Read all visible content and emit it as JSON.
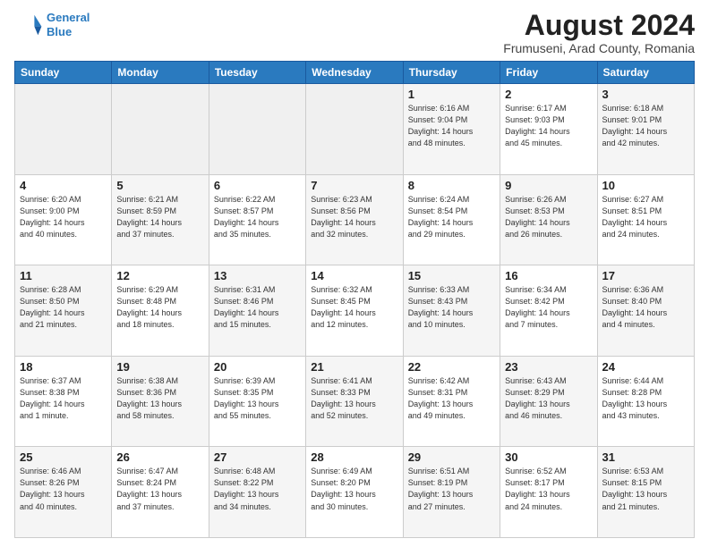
{
  "header": {
    "logo_line1": "General",
    "logo_line2": "Blue",
    "month": "August 2024",
    "location": "Frumuseni, Arad County, Romania"
  },
  "weekdays": [
    "Sunday",
    "Monday",
    "Tuesday",
    "Wednesday",
    "Thursday",
    "Friday",
    "Saturday"
  ],
  "weeks": [
    [
      {
        "day": "",
        "info": "",
        "empty": true
      },
      {
        "day": "",
        "info": "",
        "empty": true
      },
      {
        "day": "",
        "info": "",
        "empty": true
      },
      {
        "day": "",
        "info": "",
        "empty": true
      },
      {
        "day": "1",
        "info": "Sunrise: 6:16 AM\nSunset: 9:04 PM\nDaylight: 14 hours\nand 48 minutes.",
        "empty": false
      },
      {
        "day": "2",
        "info": "Sunrise: 6:17 AM\nSunset: 9:03 PM\nDaylight: 14 hours\nand 45 minutes.",
        "empty": false
      },
      {
        "day": "3",
        "info": "Sunrise: 6:18 AM\nSunset: 9:01 PM\nDaylight: 14 hours\nand 42 minutes.",
        "empty": false
      }
    ],
    [
      {
        "day": "4",
        "info": "Sunrise: 6:20 AM\nSunset: 9:00 PM\nDaylight: 14 hours\nand 40 minutes.",
        "empty": false
      },
      {
        "day": "5",
        "info": "Sunrise: 6:21 AM\nSunset: 8:59 PM\nDaylight: 14 hours\nand 37 minutes.",
        "empty": false
      },
      {
        "day": "6",
        "info": "Sunrise: 6:22 AM\nSunset: 8:57 PM\nDaylight: 14 hours\nand 35 minutes.",
        "empty": false
      },
      {
        "day": "7",
        "info": "Sunrise: 6:23 AM\nSunset: 8:56 PM\nDaylight: 14 hours\nand 32 minutes.",
        "empty": false
      },
      {
        "day": "8",
        "info": "Sunrise: 6:24 AM\nSunset: 8:54 PM\nDaylight: 14 hours\nand 29 minutes.",
        "empty": false
      },
      {
        "day": "9",
        "info": "Sunrise: 6:26 AM\nSunset: 8:53 PM\nDaylight: 14 hours\nand 26 minutes.",
        "empty": false
      },
      {
        "day": "10",
        "info": "Sunrise: 6:27 AM\nSunset: 8:51 PM\nDaylight: 14 hours\nand 24 minutes.",
        "empty": false
      }
    ],
    [
      {
        "day": "11",
        "info": "Sunrise: 6:28 AM\nSunset: 8:50 PM\nDaylight: 14 hours\nand 21 minutes.",
        "empty": false
      },
      {
        "day": "12",
        "info": "Sunrise: 6:29 AM\nSunset: 8:48 PM\nDaylight: 14 hours\nand 18 minutes.",
        "empty": false
      },
      {
        "day": "13",
        "info": "Sunrise: 6:31 AM\nSunset: 8:46 PM\nDaylight: 14 hours\nand 15 minutes.",
        "empty": false
      },
      {
        "day": "14",
        "info": "Sunrise: 6:32 AM\nSunset: 8:45 PM\nDaylight: 14 hours\nand 12 minutes.",
        "empty": false
      },
      {
        "day": "15",
        "info": "Sunrise: 6:33 AM\nSunset: 8:43 PM\nDaylight: 14 hours\nand 10 minutes.",
        "empty": false
      },
      {
        "day": "16",
        "info": "Sunrise: 6:34 AM\nSunset: 8:42 PM\nDaylight: 14 hours\nand 7 minutes.",
        "empty": false
      },
      {
        "day": "17",
        "info": "Sunrise: 6:36 AM\nSunset: 8:40 PM\nDaylight: 14 hours\nand 4 minutes.",
        "empty": false
      }
    ],
    [
      {
        "day": "18",
        "info": "Sunrise: 6:37 AM\nSunset: 8:38 PM\nDaylight: 14 hours\nand 1 minute.",
        "empty": false
      },
      {
        "day": "19",
        "info": "Sunrise: 6:38 AM\nSunset: 8:36 PM\nDaylight: 13 hours\nand 58 minutes.",
        "empty": false
      },
      {
        "day": "20",
        "info": "Sunrise: 6:39 AM\nSunset: 8:35 PM\nDaylight: 13 hours\nand 55 minutes.",
        "empty": false
      },
      {
        "day": "21",
        "info": "Sunrise: 6:41 AM\nSunset: 8:33 PM\nDaylight: 13 hours\nand 52 minutes.",
        "empty": false
      },
      {
        "day": "22",
        "info": "Sunrise: 6:42 AM\nSunset: 8:31 PM\nDaylight: 13 hours\nand 49 minutes.",
        "empty": false
      },
      {
        "day": "23",
        "info": "Sunrise: 6:43 AM\nSunset: 8:29 PM\nDaylight: 13 hours\nand 46 minutes.",
        "empty": false
      },
      {
        "day": "24",
        "info": "Sunrise: 6:44 AM\nSunset: 8:28 PM\nDaylight: 13 hours\nand 43 minutes.",
        "empty": false
      }
    ],
    [
      {
        "day": "25",
        "info": "Sunrise: 6:46 AM\nSunset: 8:26 PM\nDaylight: 13 hours\nand 40 minutes.",
        "empty": false
      },
      {
        "day": "26",
        "info": "Sunrise: 6:47 AM\nSunset: 8:24 PM\nDaylight: 13 hours\nand 37 minutes.",
        "empty": false
      },
      {
        "day": "27",
        "info": "Sunrise: 6:48 AM\nSunset: 8:22 PM\nDaylight: 13 hours\nand 34 minutes.",
        "empty": false
      },
      {
        "day": "28",
        "info": "Sunrise: 6:49 AM\nSunset: 8:20 PM\nDaylight: 13 hours\nand 30 minutes.",
        "empty": false
      },
      {
        "day": "29",
        "info": "Sunrise: 6:51 AM\nSunset: 8:19 PM\nDaylight: 13 hours\nand 27 minutes.",
        "empty": false
      },
      {
        "day": "30",
        "info": "Sunrise: 6:52 AM\nSunset: 8:17 PM\nDaylight: 13 hours\nand 24 minutes.",
        "empty": false
      },
      {
        "day": "31",
        "info": "Sunrise: 6:53 AM\nSunset: 8:15 PM\nDaylight: 13 hours\nand 21 minutes.",
        "empty": false
      }
    ]
  ]
}
